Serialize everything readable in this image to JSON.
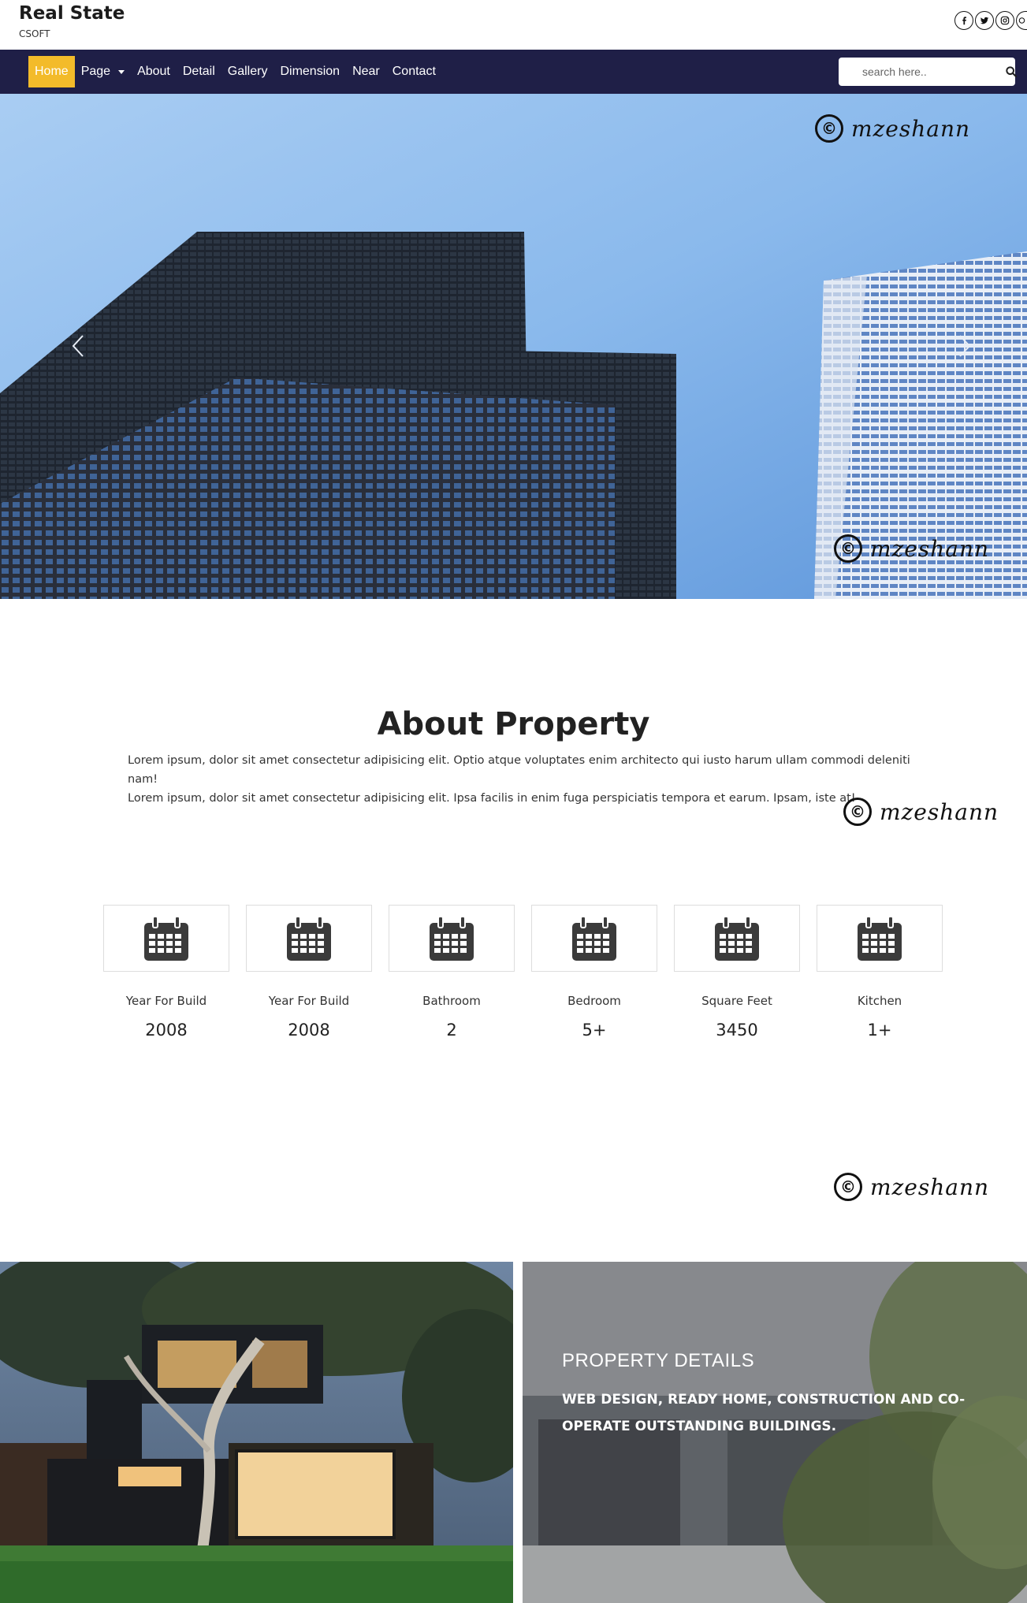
{
  "header": {
    "title": "Real State",
    "subtitle": "CSOFT",
    "social_icons": [
      "facebook-icon",
      "twitter-icon",
      "instagram-icon",
      "pinterest-icon"
    ]
  },
  "nav": {
    "items": [
      {
        "label": "Home",
        "active": true
      },
      {
        "label": "Page",
        "dropdown": true
      },
      {
        "label": "About"
      },
      {
        "label": "Detail"
      },
      {
        "label": "Gallery"
      },
      {
        "label": "Dimension"
      },
      {
        "label": "Near"
      },
      {
        "label": "Contact"
      }
    ],
    "search": {
      "placeholder": "search here..",
      "icon": "search-icon"
    }
  },
  "hero": {
    "prev_icon": "chevron-left-icon",
    "next_icon": "chevron-right-icon"
  },
  "watermark": {
    "symbol": "©",
    "text": "mzeshann"
  },
  "about": {
    "title_bold": "About",
    "title_rest": "Property",
    "text_line1": "Lorem ipsum, dolor sit amet consectetur adipisicing elit. Optio atque voluptates enim architecto qui iusto harum ullam commodi deleniti nam!",
    "text_line2": "Lorem ipsum, dolor sit amet consectetur adipisicing elit. Ipsa facilis in enim fuga perspiciatis tempora et earum. Ipsam, iste at!"
  },
  "stats": [
    {
      "label": "Year For Build",
      "value": "2008",
      "icon": "calendar-icon"
    },
    {
      "label": "Year For Build",
      "value": "2008",
      "icon": "calendar-icon"
    },
    {
      "label": "Bathroom",
      "value": "2",
      "icon": "calendar-icon"
    },
    {
      "label": "Bedroom",
      "value": "5+",
      "icon": "calendar-icon"
    },
    {
      "label": "Square Feet",
      "value": "3450",
      "icon": "calendar-icon"
    },
    {
      "label": "Kitchen",
      "value": "1+",
      "icon": "calendar-icon"
    }
  ],
  "property_details": {
    "title": "PROPERTY DETAILS",
    "subtitle": "WEB DESIGN, READY HOME, CONSTRUCTION AND CO-OPERATE OUTSTANDING BUILDINGS."
  },
  "colors": {
    "navbar": "#1f1f47",
    "active": "#f3bb2a"
  }
}
